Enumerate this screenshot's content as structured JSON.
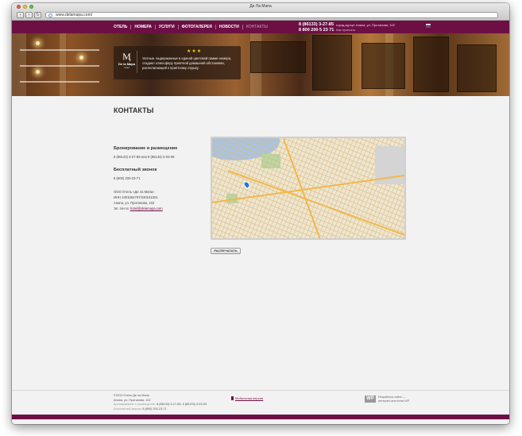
{
  "browser": {
    "window_title": "Де Ла Мапа",
    "url": "www.delamapa.com/",
    "back_glyph": "‹",
    "forward_glyph": "›",
    "reload_glyph": "↻"
  },
  "header": {
    "nav": [
      "ОТЕЛЬ",
      "НОМЕРА",
      "УСЛУГИ",
      "ФОТОГАЛЕРЕЯ",
      "НОВОСТИ",
      "КОНТАКТЫ"
    ],
    "active_nav": "КОНТАКТЫ",
    "phone_1": "8 (86133) 3-27-85",
    "phone_2": "8 800 200 5 23 71",
    "address": "город-курорт Анапа, ул. Протапова, 102",
    "address_link": "Как проехать",
    "accent_color": "#6d0f44"
  },
  "hero": {
    "logo_mark": "Ӎ",
    "logo_name": "De la Mapa",
    "logo_sub": "hotel",
    "stars": "★★★",
    "tagline": "Уютные, выдержанные в единой цветовой гамме номера, создают атмосферу приятной домашней обстановки, располагающей к приятному отдыху."
  },
  "page": {
    "title": "КОНТАКТЫ",
    "booking_heading": "Бронирование и размещение",
    "booking_phones": "8 (86133) 3-27-85 или 8 (86133) 3-03-09",
    "free_call_heading": "Бесплатный звонок",
    "free_call_phone": "8 (800) 200-23-71",
    "company": "ООО Отель «Де ла Мапа»",
    "inn": "ИНН 2301064797/230101001",
    "street": "Анапа, ул. Протапова, 102",
    "email_label": "Эл. почта:",
    "email": "hotel@delamapa.com",
    "print_button": "РАСПЕЧАТАТЬ"
  },
  "footer": {
    "copyright": "©2013 Отель Де ла Мапа",
    "street": "Анапа, ул. Протапова, 102",
    "booking_label": "Бронирование и размещение:",
    "booking_phones": "8 (86133) 3-27-85, 8 (86133) 3-03-09",
    "free_call_label": "Бесплатный звонок:",
    "free_call_phone": "8 (800) 200-23-71",
    "mobile_link": "Мобильная версия",
    "dev_badge": "WP",
    "dev_text_1": "Разработка сайта —",
    "dev_text_2": "интернет-агентство WP"
  }
}
